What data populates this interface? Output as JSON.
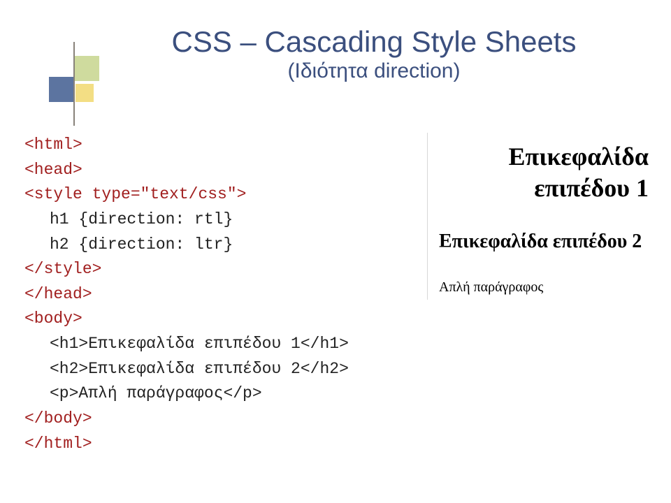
{
  "title": "CSS – Cascading Style Sheets",
  "subtitle": "(Ιδιότητα direction)",
  "code": {
    "l1": "<html>",
    "l2": "<head>",
    "l3": "<style type=\"text/css\">",
    "l4": "h1 {direction: rtl}",
    "l5": "h2 {direction: ltr}",
    "l6": "</style>",
    "l7": "</head>",
    "l8": "<body>",
    "l9": "<h1>Επικεφαλίδα επιπέδου 1</h1>",
    "l10": "<h2>Επικεφαλίδα επιπέδου 2</h2>",
    "l11": "<p>Απλή παράγραφος</p>",
    "l12": "</body>",
    "l13": "</html>"
  },
  "preview": {
    "h1": "Επικεφαλίδα επιπέδου 1",
    "h2": "Επικεφαλίδα επιπέδου 2",
    "p": "Απλή παράγραφος"
  }
}
